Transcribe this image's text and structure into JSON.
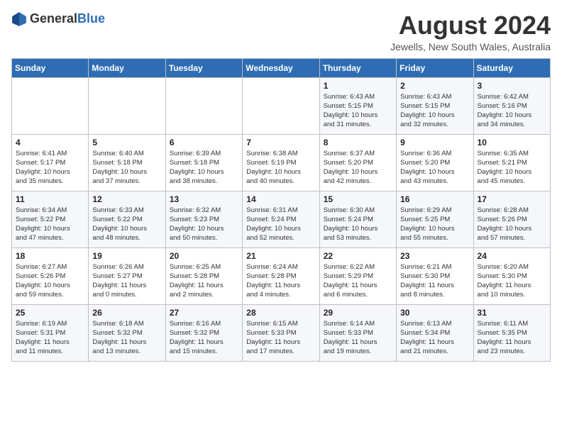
{
  "header": {
    "logo_general": "General",
    "logo_blue": "Blue",
    "month_year": "August 2024",
    "location": "Jewells, New South Wales, Australia"
  },
  "days_of_week": [
    "Sunday",
    "Monday",
    "Tuesday",
    "Wednesday",
    "Thursday",
    "Friday",
    "Saturday"
  ],
  "weeks": [
    [
      {
        "day": "",
        "content": ""
      },
      {
        "day": "",
        "content": ""
      },
      {
        "day": "",
        "content": ""
      },
      {
        "day": "",
        "content": ""
      },
      {
        "day": "1",
        "content": "Sunrise: 6:43 AM\nSunset: 5:15 PM\nDaylight: 10 hours\nand 31 minutes."
      },
      {
        "day": "2",
        "content": "Sunrise: 6:43 AM\nSunset: 5:15 PM\nDaylight: 10 hours\nand 32 minutes."
      },
      {
        "day": "3",
        "content": "Sunrise: 6:42 AM\nSunset: 5:16 PM\nDaylight: 10 hours\nand 34 minutes."
      }
    ],
    [
      {
        "day": "4",
        "content": "Sunrise: 6:41 AM\nSunset: 5:17 PM\nDaylight: 10 hours\nand 35 minutes."
      },
      {
        "day": "5",
        "content": "Sunrise: 6:40 AM\nSunset: 5:18 PM\nDaylight: 10 hours\nand 37 minutes."
      },
      {
        "day": "6",
        "content": "Sunrise: 6:39 AM\nSunset: 5:18 PM\nDaylight: 10 hours\nand 38 minutes."
      },
      {
        "day": "7",
        "content": "Sunrise: 6:38 AM\nSunset: 5:19 PM\nDaylight: 10 hours\nand 40 minutes."
      },
      {
        "day": "8",
        "content": "Sunrise: 6:37 AM\nSunset: 5:20 PM\nDaylight: 10 hours\nand 42 minutes."
      },
      {
        "day": "9",
        "content": "Sunrise: 6:36 AM\nSunset: 5:20 PM\nDaylight: 10 hours\nand 43 minutes."
      },
      {
        "day": "10",
        "content": "Sunrise: 6:35 AM\nSunset: 5:21 PM\nDaylight: 10 hours\nand 45 minutes."
      }
    ],
    [
      {
        "day": "11",
        "content": "Sunrise: 6:34 AM\nSunset: 5:22 PM\nDaylight: 10 hours\nand 47 minutes."
      },
      {
        "day": "12",
        "content": "Sunrise: 6:33 AM\nSunset: 5:22 PM\nDaylight: 10 hours\nand 48 minutes."
      },
      {
        "day": "13",
        "content": "Sunrise: 6:32 AM\nSunset: 5:23 PM\nDaylight: 10 hours\nand 50 minutes."
      },
      {
        "day": "14",
        "content": "Sunrise: 6:31 AM\nSunset: 5:24 PM\nDaylight: 10 hours\nand 52 minutes."
      },
      {
        "day": "15",
        "content": "Sunrise: 6:30 AM\nSunset: 5:24 PM\nDaylight: 10 hours\nand 53 minutes."
      },
      {
        "day": "16",
        "content": "Sunrise: 6:29 AM\nSunset: 5:25 PM\nDaylight: 10 hours\nand 55 minutes."
      },
      {
        "day": "17",
        "content": "Sunrise: 6:28 AM\nSunset: 5:26 PM\nDaylight: 10 hours\nand 57 minutes."
      }
    ],
    [
      {
        "day": "18",
        "content": "Sunrise: 6:27 AM\nSunset: 5:26 PM\nDaylight: 10 hours\nand 59 minutes."
      },
      {
        "day": "19",
        "content": "Sunrise: 6:26 AM\nSunset: 5:27 PM\nDaylight: 11 hours\nand 0 minutes."
      },
      {
        "day": "20",
        "content": "Sunrise: 6:25 AM\nSunset: 5:28 PM\nDaylight: 11 hours\nand 2 minutes."
      },
      {
        "day": "21",
        "content": "Sunrise: 6:24 AM\nSunset: 5:28 PM\nDaylight: 11 hours\nand 4 minutes."
      },
      {
        "day": "22",
        "content": "Sunrise: 6:22 AM\nSunset: 5:29 PM\nDaylight: 11 hours\nand 6 minutes."
      },
      {
        "day": "23",
        "content": "Sunrise: 6:21 AM\nSunset: 5:30 PM\nDaylight: 11 hours\nand 8 minutes."
      },
      {
        "day": "24",
        "content": "Sunrise: 6:20 AM\nSunset: 5:30 PM\nDaylight: 11 hours\nand 10 minutes."
      }
    ],
    [
      {
        "day": "25",
        "content": "Sunrise: 6:19 AM\nSunset: 5:31 PM\nDaylight: 11 hours\nand 11 minutes."
      },
      {
        "day": "26",
        "content": "Sunrise: 6:18 AM\nSunset: 5:32 PM\nDaylight: 11 hours\nand 13 minutes."
      },
      {
        "day": "27",
        "content": "Sunrise: 6:16 AM\nSunset: 5:32 PM\nDaylight: 11 hours\nand 15 minutes."
      },
      {
        "day": "28",
        "content": "Sunrise: 6:15 AM\nSunset: 5:33 PM\nDaylight: 11 hours\nand 17 minutes."
      },
      {
        "day": "29",
        "content": "Sunrise: 6:14 AM\nSunset: 5:33 PM\nDaylight: 11 hours\nand 19 minutes."
      },
      {
        "day": "30",
        "content": "Sunrise: 6:13 AM\nSunset: 5:34 PM\nDaylight: 11 hours\nand 21 minutes."
      },
      {
        "day": "31",
        "content": "Sunrise: 6:11 AM\nSunset: 5:35 PM\nDaylight: 11 hours\nand 23 minutes."
      }
    ]
  ]
}
